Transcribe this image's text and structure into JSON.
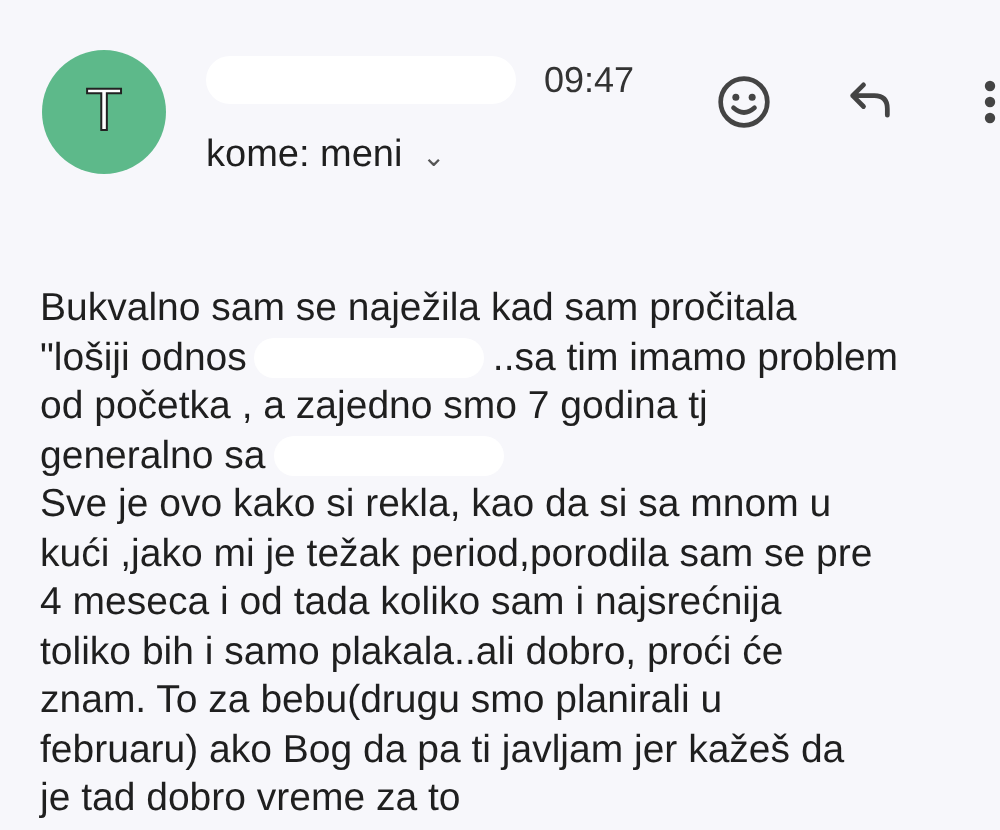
{
  "header": {
    "avatar_letter": "T",
    "time": "09:47",
    "recipient": "kome: meni",
    "recipient_caret": "⌄"
  },
  "body": [
    [
      {
        "kind": "text",
        "text": "Bukvalno sam se naježila kad sam pročitala"
      }
    ],
    [
      {
        "kind": "text",
        "text": "\"lošiji odnos"
      },
      {
        "kind": "redaction"
      },
      {
        "kind": "text",
        "text": "..sa tim imamo problem"
      }
    ],
    [
      {
        "kind": "text",
        "text": "od početka , a zajedno smo 7 godina tj"
      }
    ],
    [
      {
        "kind": "text",
        "text": "generalno sa"
      },
      {
        "kind": "redaction"
      }
    ],
    [
      {
        "kind": "text",
        "text": "Sve je ovo kako si rekla, kao da si sa mnom u"
      }
    ],
    [
      {
        "kind": "text",
        "text": "kući ,jako mi je težak period,porodila sam se pre"
      }
    ],
    [
      {
        "kind": "text",
        "text": "4 meseca i od tada koliko sam i najsrećnija"
      }
    ],
    [
      {
        "kind": "text",
        "text": "toliko bih i samo plakala..ali dobro, proći će"
      }
    ],
    [
      {
        "kind": "text",
        "text": "znam. To za bebu(drugu smo planirali u"
      }
    ],
    [
      {
        "kind": "text",
        "text": "februaru) ako Bog da pa ti javljam jer kažeš da"
      }
    ],
    [
      {
        "kind": "text",
        "text": "je tad dobro vreme za to"
      }
    ]
  ]
}
